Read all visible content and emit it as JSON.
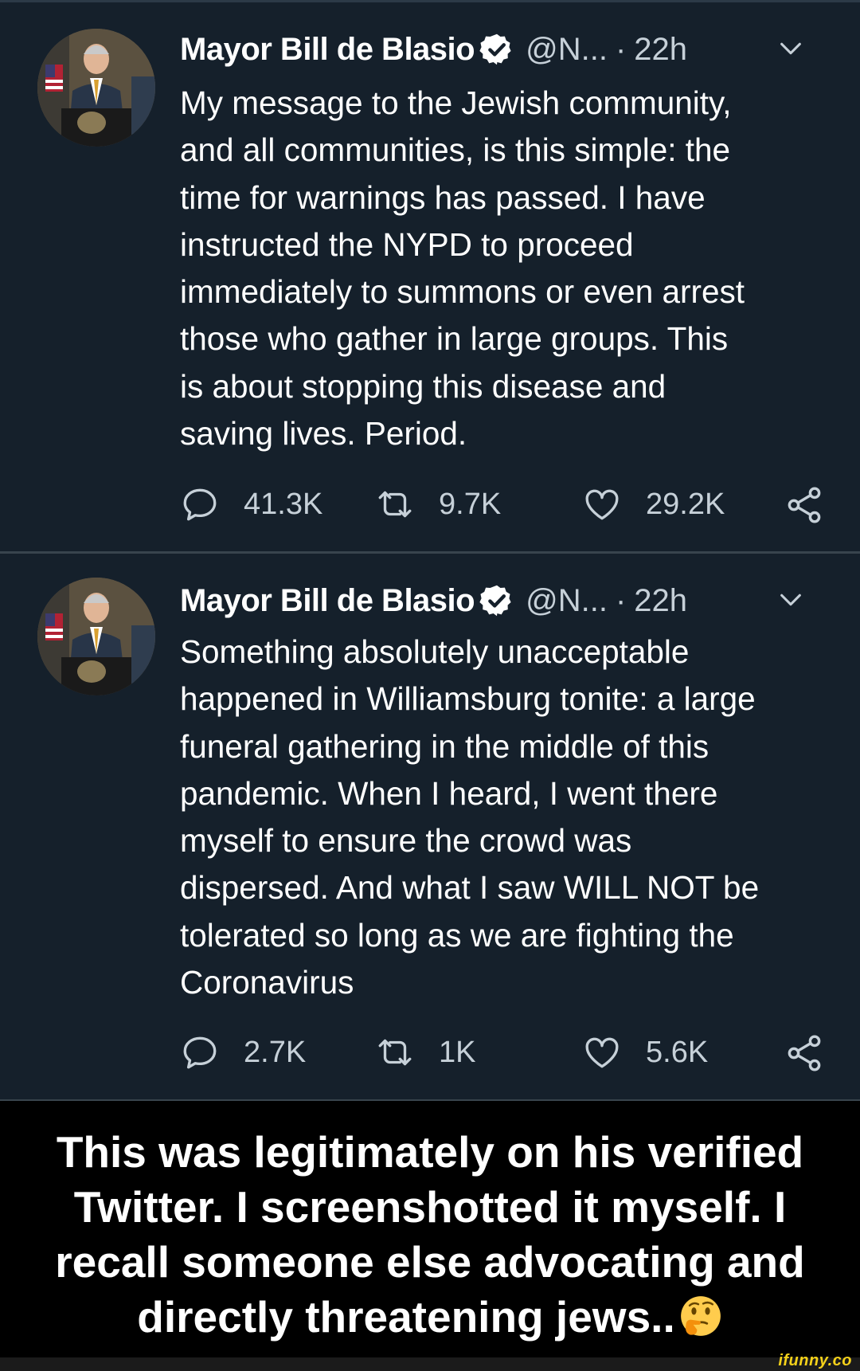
{
  "tweets": [
    {
      "author": "Mayor Bill de Blasio",
      "handle": "@N...",
      "separator": "·",
      "time": "22h",
      "lines": [
        "My message to the Jewish community,",
        "and all communities, is this simple: the",
        "time for warnings has passed. I have",
        "instructed the NYPD to proceed",
        "immediately to summons or even arrest",
        "those who gather in large groups. This",
        "is about stopping this disease and",
        "saving lives. Period."
      ],
      "replies": "41.3K",
      "retweets": "9.7K",
      "likes": "29.2K"
    },
    {
      "author": "Mayor Bill de Blasio",
      "handle": "@N...",
      "separator": "·",
      "time": "22h",
      "lines": [
        "Something absolutely unacceptable",
        "happened in Williamsburg tonite: a large",
        "funeral gathering in the middle of this",
        "pandemic. When I heard, I went there",
        "myself to ensure the crowd was",
        "dispersed. And what I saw WILL NOT be",
        "tolerated so long as we are fighting the",
        "Coronavirus"
      ],
      "replies": "2.7K",
      "retweets": "1K",
      "likes": "5.6K"
    }
  ],
  "caption": {
    "lines": [
      "This was legitimately on his verified",
      "Twitter. I screenshotted it myself. I",
      "recall someone else advocating and",
      "directly threatening jews.."
    ],
    "emoji": "thinking-face-icon"
  },
  "watermark": "ifunny.co",
  "colors": {
    "background": "#15202b",
    "muted": "#8899a6",
    "caption_bg": "#000000",
    "watermark": "#f5d21a"
  }
}
